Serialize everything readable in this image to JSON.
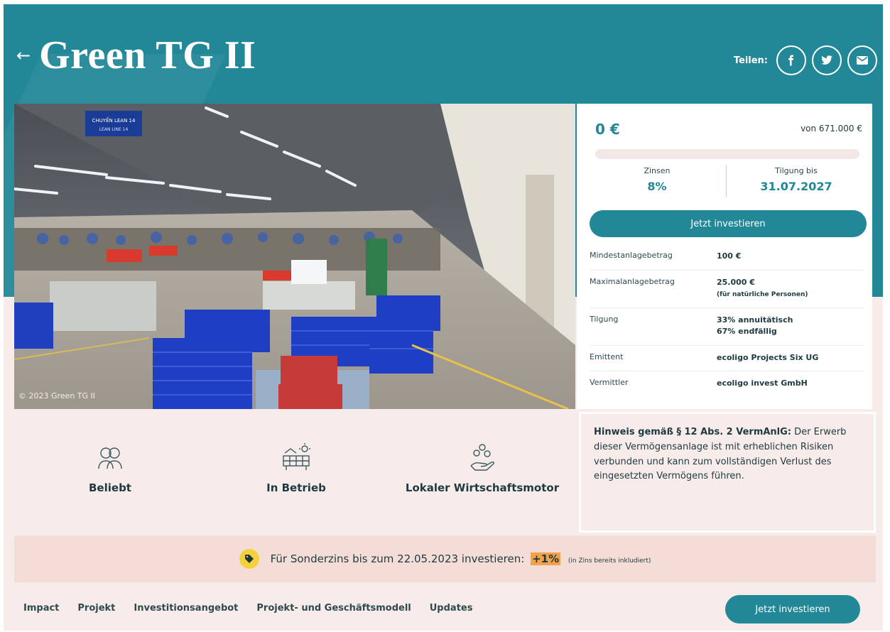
{
  "header": {
    "back_label": "←",
    "title": "Green TG II",
    "share_label": "Teilen:",
    "share_buttons": [
      {
        "icon": "facebook-icon"
      },
      {
        "icon": "twitter-icon"
      },
      {
        "icon": "mail-icon"
      }
    ]
  },
  "photo": {
    "credit": "© 2023 Green TG II",
    "sign_line1": "CHUYỀN LEAN 14",
    "sign_line2": "LEAN LINE 14"
  },
  "investment": {
    "raised": "0 €",
    "goal": "von 671.000 €",
    "progress_fraction": 0,
    "stats": [
      {
        "label": "Zinsen",
        "value": "8%"
      },
      {
        "label": "Tilgung bis",
        "value": "31.07.2027"
      }
    ],
    "cta": "Jetzt investieren",
    "details": [
      {
        "key": "Mindestanlagebetrag",
        "value": "100 €",
        "note": ""
      },
      {
        "key": "Maximalanlagebetrag",
        "value": "25.000 €",
        "note": "(für natürliche Personen)"
      },
      {
        "key": "Tilgung",
        "value": "33% annuitätisch",
        "value2": "67% endfällig",
        "note": ""
      },
      {
        "key": "Emittent",
        "value": "ecoligo Projects Six UG",
        "note": ""
      },
      {
        "key": "Vermittler",
        "value": "ecoligo invest GmbH",
        "note": ""
      }
    ]
  },
  "features": [
    {
      "icon": "people-icon",
      "label": "Beliebt"
    },
    {
      "icon": "solar-plant-icon",
      "label": "In Betrieb"
    },
    {
      "icon": "coins-hand-icon",
      "label": "Lokaler Wirtschaftsmotor"
    }
  ],
  "notice": {
    "heading": "Hinweis gemäß § 12 Abs. 2 VermAnlG:",
    "text": "Der Erwerb dieser Vermögensanlage ist mit erheblichen Risiken verbunden und kann zum vollständigen Verlust des eingesetzten Vermögens führen."
  },
  "promo": {
    "text": "Für Sonderzins bis zum 22.05.2023 investieren:",
    "bonus": "+1%",
    "note": "(in Zins bereits inkludiert)"
  },
  "nav": {
    "items": [
      "Impact",
      "Projekt",
      "Investitionsangebot",
      "Projekt- und Geschäftsmodell",
      "Updates"
    ],
    "cta": "Jetzt investieren"
  },
  "colors": {
    "brand": "#228797",
    "background": "#f8ecea",
    "promo_badge": "#f5d23b",
    "promo_highlight": "#f2a24a"
  }
}
